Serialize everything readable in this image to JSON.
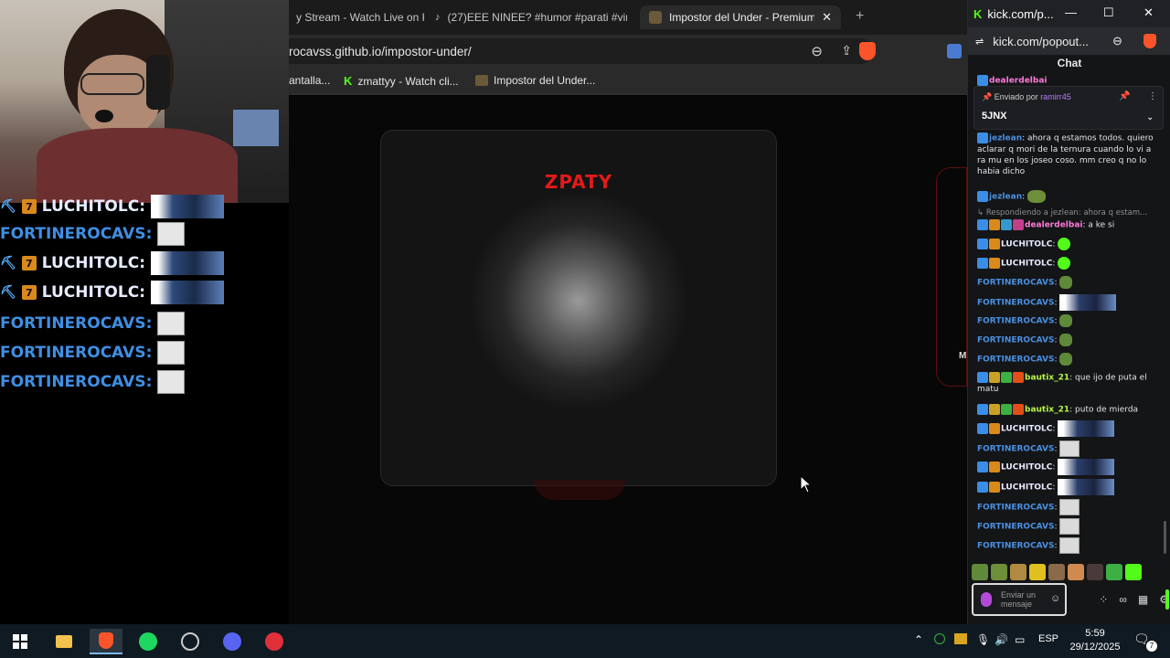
{
  "browser": {
    "tabs": [
      {
        "label": "y Stream - Watch Live on K",
        "icon": "stream-tab-icon"
      },
      {
        "label": "(27)EEE NINEE? #humor #parati #vira",
        "icon": "tiktok-icon"
      },
      {
        "label": "Impostor del Under - Premium E",
        "icon": "game-tab-icon",
        "active": true
      }
    ],
    "new_tab": "+",
    "url": "rocavss.github.io/impostor-under/",
    "bookmarks": [
      {
        "label": "antalla..."
      },
      {
        "label": "zmattyy - Watch cli..."
      },
      {
        "label": "Impostor del Under..."
      }
    ]
  },
  "page": {
    "card_title": "ZPATY",
    "side_letter": "M"
  },
  "overlay_chat": {
    "rows": [
      {
        "name": "LUCHITOLC:",
        "style": "white",
        "emote": "wide"
      },
      {
        "name": "FORTINEROCAVS:",
        "style": "blue",
        "emote": "small"
      },
      {
        "name": "LUCHITOLC:",
        "style": "white",
        "emote": "wide"
      },
      {
        "name": "LUCHITOLC:",
        "style": "white",
        "emote": "wide"
      },
      {
        "name": "FORTINEROCAVS:",
        "style": "blue",
        "emote": "small"
      },
      {
        "name": "FORTINEROCAVS:",
        "style": "blue",
        "emote": "small"
      },
      {
        "name": "FORTINEROCAVS:",
        "style": "blue",
        "emote": "small"
      }
    ]
  },
  "kick": {
    "window_title": "kick.com/p...",
    "address": "kick.com/popout...",
    "chat_header": "Chat",
    "pinned": {
      "sent_by_label": "Enviado por",
      "sent_by_user": "ramirr45",
      "text": "5JNX"
    },
    "messages": [
      {
        "user": "dealerdelbai",
        "text": ""
      },
      {
        "user": "jezlean",
        "text": "ahora q estamos todos. quiero aclarar q mori de la ternura cuando lo vi a ra mu en los joseo coso. mm creo q no lo habia dicho"
      },
      {
        "user": "jezlean",
        "text": ""
      },
      {
        "reply": "Respondiendo a jezlean: ahora q estam..."
      },
      {
        "user": "dealerdelbai",
        "text": "a ke si"
      },
      {
        "user": "LUCHITOLC",
        "text": ""
      },
      {
        "user": "LUCHITOLC",
        "text": ""
      },
      {
        "user": "FORTINEROCAVS",
        "text": ""
      },
      {
        "user": "FORTINEROCAVS",
        "text": ""
      },
      {
        "user": "FORTINEROCAVS",
        "text": ""
      },
      {
        "user": "FORTINEROCAVS",
        "text": ""
      },
      {
        "user": "FORTINEROCAVS",
        "text": ""
      },
      {
        "user": "bautix_21",
        "text": "que ijo de puta el matu"
      },
      {
        "user": "bautix_21",
        "text": "puto de mierda"
      },
      {
        "user": "LUCHITOLC",
        "text": ""
      },
      {
        "user": "FORTINEROCAVS",
        "text": ""
      },
      {
        "user": "LUCHITOLC",
        "text": ""
      },
      {
        "user": "LUCHITOLC",
        "text": ""
      },
      {
        "user": "FORTINEROCAVS",
        "text": ""
      },
      {
        "user": "FORTINEROCAVS",
        "text": ""
      },
      {
        "user": "FORTINEROCAVS",
        "text": ""
      }
    ],
    "input_placeholder": "Enviar un mensaje"
  },
  "taskbar": {
    "language": "ESP",
    "time": "5:59",
    "date": "29/12/2025",
    "notifications": "7"
  },
  "colors": {
    "kick_green": "#53fc18",
    "zpaty_red": "#e21a1a",
    "overlay_blue": "#3f8fe3"
  }
}
